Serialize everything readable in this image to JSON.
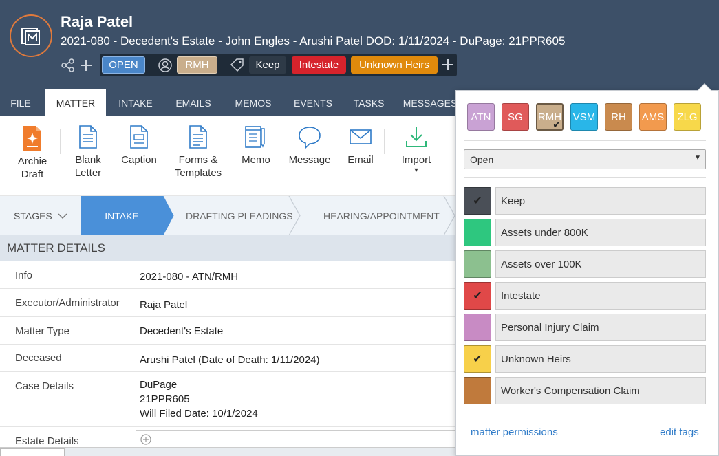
{
  "header": {
    "title": "Raja Patel",
    "subtitle": "2021-080 - Decedent's Estate - John Engles - Arushi Patel DOD: 1/11/2024 - DuPage: 21PPR605",
    "status_tag": "OPEN",
    "user_tag": "RMH",
    "tags": [
      {
        "label": "Keep",
        "color": "#2e3a47"
      },
      {
        "label": "Intestate",
        "color": "#d6232c"
      },
      {
        "label": "Unknown Heirs",
        "color": "#e08a0c"
      }
    ],
    "status_color": "#4a86c8",
    "user_color": "#c9ae8c"
  },
  "tabs": [
    "FILE",
    "MATTER",
    "INTAKE",
    "EMAILS",
    "MEMOS",
    "EVENTS",
    "TASKS",
    "MESSAGES"
  ],
  "toolbar": {
    "archie_line1": "Archie",
    "archie_line2": "Draft",
    "blank_line1": "Blank",
    "blank_line2": "Letter",
    "caption": "Caption",
    "forms_line1": "Forms &",
    "forms_line2": "Templates",
    "memo": "Memo",
    "message": "Message",
    "email": "Email",
    "import": "Import"
  },
  "stages": {
    "label": "STAGES",
    "items": [
      "INTAKE",
      "DRAFTING PLEADINGS",
      "HEARING/APPOINTMENT"
    ]
  },
  "matter_details": {
    "heading": "MATTER DETAILS",
    "rows": [
      {
        "label": "Info",
        "value": "2021-080 - ATN/RMH"
      },
      {
        "label": "Executor/Administrator",
        "value": "Raja Patel"
      },
      {
        "label": "Matter Type",
        "value": "Decedent's Estate"
      },
      {
        "label": "Deceased",
        "value": "Arushi Patel (Date of Death: 1/11/2024)"
      },
      {
        "label": "Case Details",
        "value": "DuPage",
        "value2": "21PPR605",
        "value3": "Will Filed Date: 10/1/2024"
      },
      {
        "label": "Estate Details",
        "value": ""
      }
    ]
  },
  "panel": {
    "users": [
      {
        "label": "ATN",
        "color": "#c9a2d4",
        "selected": false
      },
      {
        "label": "SG",
        "color": "#e05a5a",
        "selected": false
      },
      {
        "label": "RMH",
        "color": "#c9ae8c",
        "selected": true
      },
      {
        "label": "VSM",
        "color": "#29b6e8",
        "selected": false
      },
      {
        "label": "RH",
        "color": "#c98a4e",
        "selected": false
      },
      {
        "label": "AMS",
        "color": "#f29a4e",
        "selected": false
      },
      {
        "label": "ZLG",
        "color": "#f7d84a",
        "selected": false
      }
    ],
    "status_value": "Open",
    "tags": [
      {
        "label": "Keep",
        "color": "#4a4f57",
        "checked": true
      },
      {
        "label": "Assets under 800K",
        "color": "#2ec77f",
        "checked": false
      },
      {
        "label": "Assets over 100K",
        "color": "#8cc08f",
        "checked": false
      },
      {
        "label": "Intestate",
        "color": "#e04848",
        "checked": true
      },
      {
        "label": "Personal Injury Claim",
        "color": "#c88bc4",
        "checked": false
      },
      {
        "label": "Unknown Heirs",
        "color": "#f7d04a",
        "checked": true
      },
      {
        "label": "Worker's Compensation Claim",
        "color": "#c07a3c",
        "checked": false
      }
    ],
    "permissions_link": "matter permissions",
    "edit_tags_link": "edit tags"
  }
}
